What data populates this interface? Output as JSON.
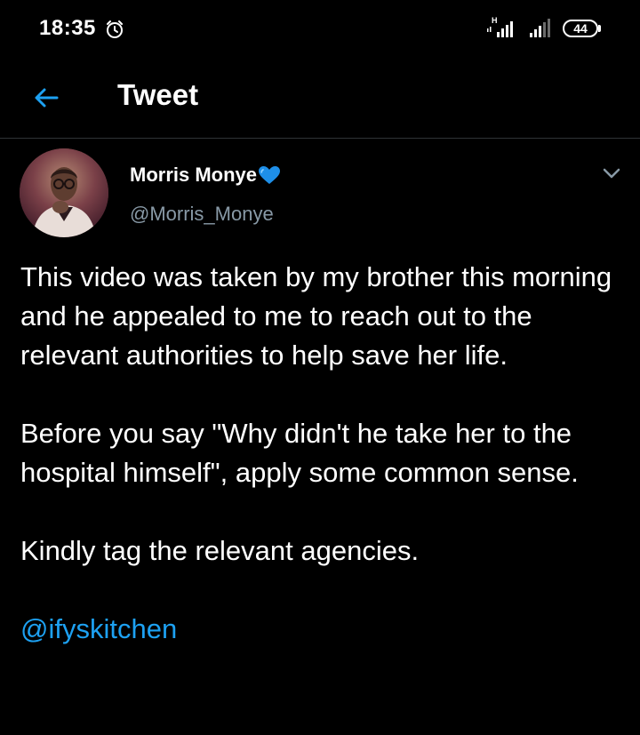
{
  "status_bar": {
    "time": "18:35",
    "network_label": "H",
    "battery": "44",
    "icons": [
      "alarm-icon",
      "signal-icon",
      "signal-icon",
      "battery-icon"
    ]
  },
  "header": {
    "title": "Tweet",
    "back_icon": "arrow-left-icon"
  },
  "tweet": {
    "author": {
      "name": "Morris Monye",
      "handle": "@Morris_Monye",
      "badge_icon": "blue-heart-icon"
    },
    "body": {
      "paragraph_1": "This video was taken by my brother this morning and he appealed to me to reach out to the relevant authorities to help save her life.",
      "paragraph_2": "Before you say \"Why didn't he take her to the hospital himself\", apply some common sense.",
      "paragraph_3": "Kindly tag the relevant agencies.",
      "mention": "@ifyskitchen"
    }
  },
  "colors": {
    "background": "#000000",
    "text": "#ffffff",
    "secondary_text": "#8899a6",
    "accent": "#1da1f2",
    "divider": "#2f3336"
  }
}
